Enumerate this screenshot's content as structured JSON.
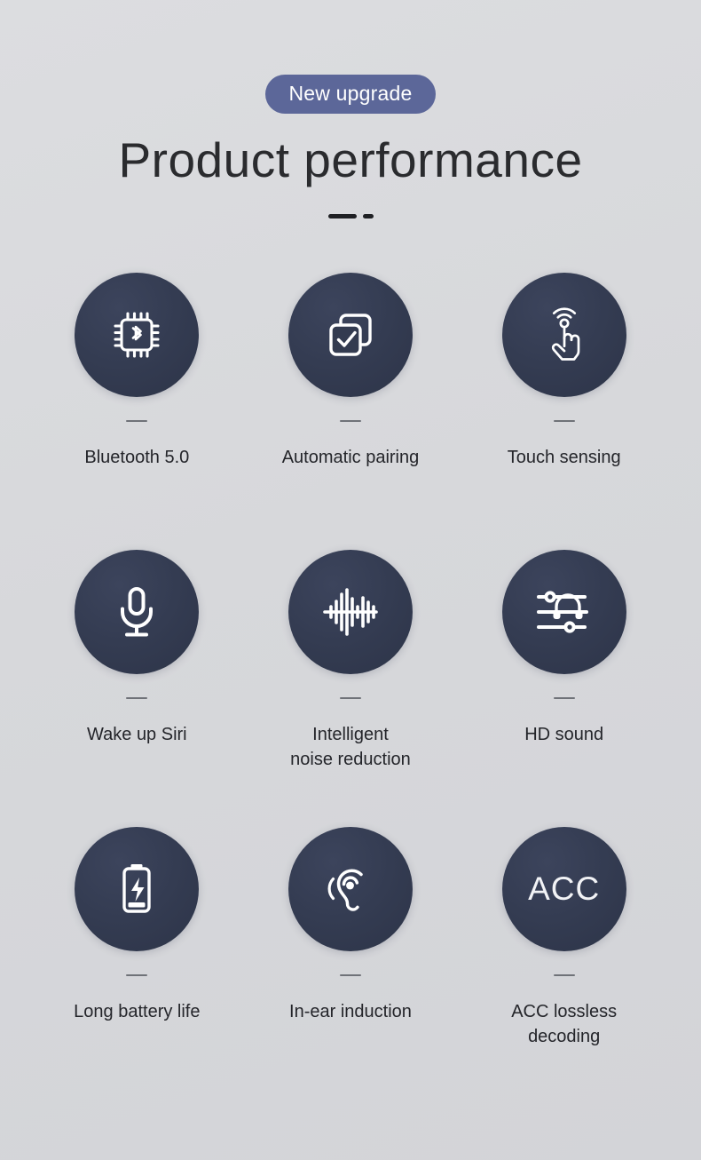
{
  "header": {
    "badge_label": "New upgrade",
    "title": "Product performance",
    "rule_long": "—",
    "rule_short": "-"
  },
  "colors": {
    "background": "#d8d9dc",
    "badge": "#5c6799",
    "circle": "#333b50",
    "title_text": "#2a2b2e",
    "label_text": "#24252a",
    "icon_stroke": "#ffffff",
    "divider": "#6f7278"
  },
  "features": [
    {
      "icon": "bluetooth-chip-icon",
      "label": "Bluetooth 5.0"
    },
    {
      "icon": "stacked-squares-check-icon",
      "label": "Automatic pairing"
    },
    {
      "icon": "touch-hand-icon",
      "label": "Touch sensing"
    },
    {
      "icon": "microphone-icon",
      "label": "Wake up Siri"
    },
    {
      "icon": "audio-waveform-icon",
      "label": "Intelligent\nnoise reduction"
    },
    {
      "icon": "equalizer-headphone-icon",
      "label": "HD sound"
    },
    {
      "icon": "battery-charging-icon",
      "label": "Long battery life"
    },
    {
      "icon": "ear-induction-icon",
      "label": "In-ear induction"
    },
    {
      "icon": "acc-text-icon",
      "icon_text": "ACC",
      "label": "ACC lossless\ndecoding"
    }
  ]
}
